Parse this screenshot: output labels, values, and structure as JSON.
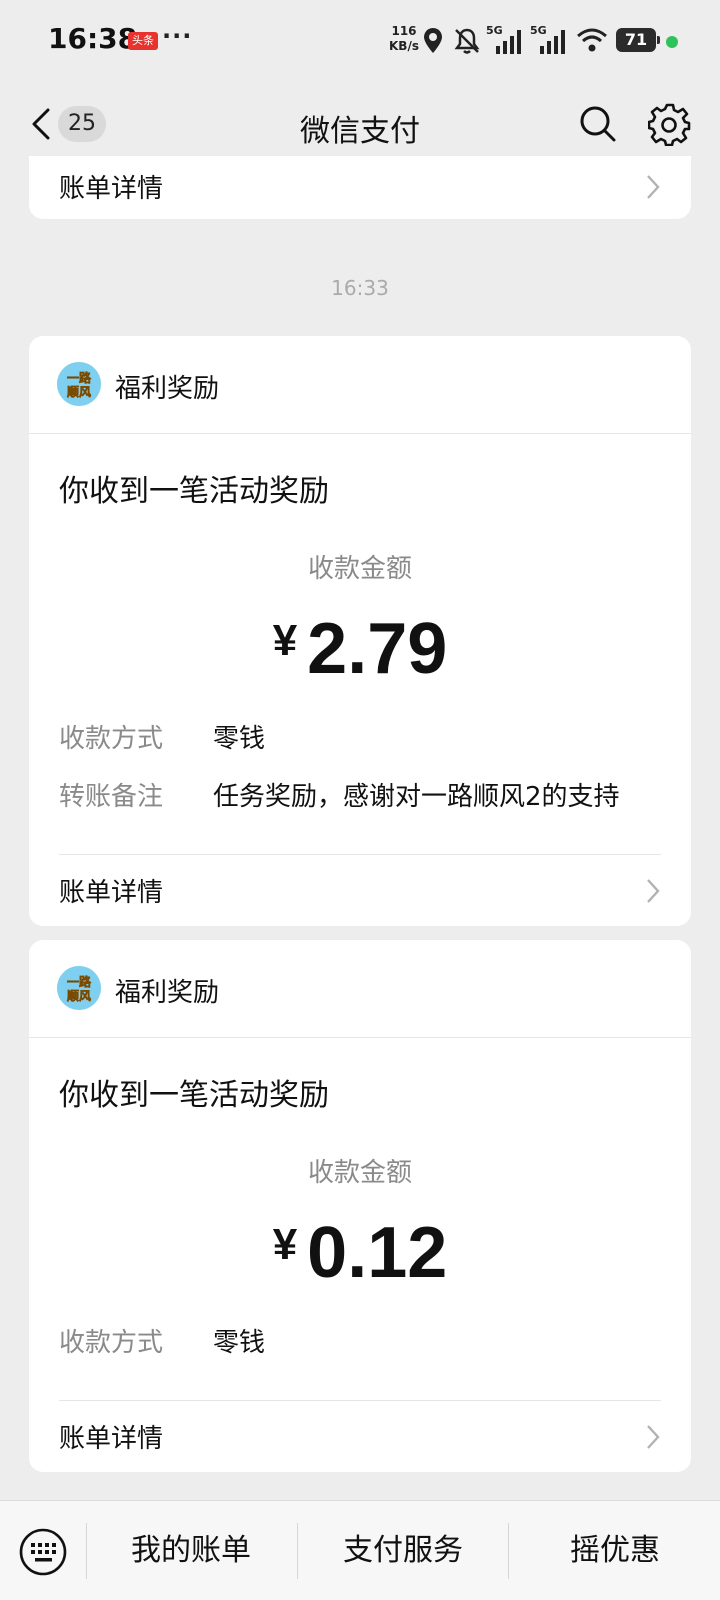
{
  "status": {
    "time": "16:38",
    "badge": "头条",
    "dots": "···",
    "net_speed_value": "116",
    "net_speed_unit": "KB/s",
    "network_1": "5G",
    "network_2": "5G",
    "battery": "71"
  },
  "nav": {
    "unread_count": "25",
    "title": "微信支付"
  },
  "top_card": {
    "detail_label": "账单详情"
  },
  "timestamp": "16:33",
  "messages": [
    {
      "source": "福利奖励",
      "avatar_text_1": "一路",
      "avatar_text_2": "顺风",
      "heading": "你收到一笔活动奖励",
      "amount_label": "收款金额",
      "currency": "¥",
      "amount": "2.79",
      "method_key": "收款方式",
      "method_val": "零钱",
      "note_key": "转账备注",
      "note_val": "任务奖励，感谢对一路顺风2的支持",
      "detail_label": "账单详情"
    },
    {
      "source": "福利奖励",
      "avatar_text_1": "一路",
      "avatar_text_2": "顺风",
      "heading": "你收到一笔活动奖励",
      "amount_label": "收款金额",
      "currency": "¥",
      "amount": "0.12",
      "method_key": "收款方式",
      "method_val": "零钱",
      "detail_label": "账单详情"
    }
  ],
  "bottom_bar": {
    "tabs": [
      "我的账单",
      "支付服务",
      "摇优惠"
    ]
  },
  "colors": {
    "background": "#ededed",
    "card": "#ffffff",
    "secondary_text": "#8a8a8a",
    "avatar": "#7fd0f0"
  },
  "icons": [
    "back-arrow-icon",
    "search-icon",
    "gear-icon",
    "chevron-right-icon",
    "keyboard-icon",
    "location-icon",
    "mute-bell-icon",
    "signal-icon",
    "wifi-icon"
  ]
}
